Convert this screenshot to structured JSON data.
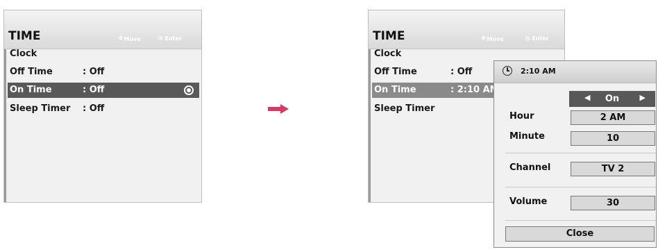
{
  "left_menu": {
    "title": "TIME",
    "hint_move": "Move",
    "hint_enter": "Enter",
    "items": [
      {
        "label": "Clock",
        "value": ""
      },
      {
        "label": "Off Time",
        "value": ": Off"
      },
      {
        "label": "On Time",
        "value": ": Off"
      },
      {
        "label": "Sleep Timer",
        "value": ": Off"
      }
    ]
  },
  "right_menu": {
    "title": "TIME",
    "hint_move": "Move",
    "hint_enter": "Enter",
    "items": [
      {
        "label": "Clock",
        "value": ""
      },
      {
        "label": "Off Time",
        "value": ": Off"
      },
      {
        "label": "On Time",
        "value": ": 2:10 AM"
      },
      {
        "label": "Sleep Timer",
        "value": ""
      }
    ]
  },
  "popup": {
    "time": "2:10 AM",
    "on_off": "On",
    "fields": {
      "hour_label": "Hour",
      "hour_value": "2 AM",
      "minute_label": "Minute",
      "minute_value": "10",
      "channel_label": "Channel",
      "channel_value": "TV 2",
      "volume_label": "Volume",
      "volume_value": "30"
    },
    "close_label": "Close"
  },
  "colors": {
    "highlight": "#585858",
    "arrow": "#d63a63"
  }
}
